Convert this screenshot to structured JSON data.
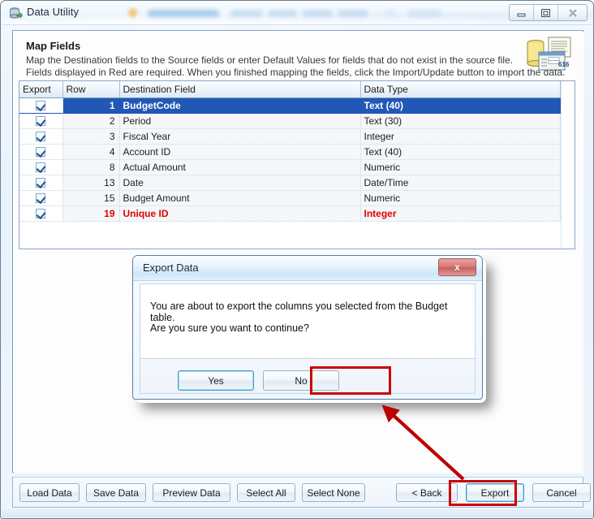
{
  "window": {
    "title": "Data Utility",
    "icon": "database-app-icon",
    "buttons": {
      "minimize": "minimize-icon",
      "restore": "restore-icon",
      "close": "close-icon"
    }
  },
  "panel": {
    "heading": "Map Fields",
    "description_line1": "Map the Destination fields to the Source fields or enter Default Values for fields that do not exist in the source file.",
    "description_line2": "Fields displayed in Red are required.  When you finished mapping the fields, click the Import/Update button to import the data.",
    "icon": "database-report-icon"
  },
  "grid": {
    "columns": [
      "Export",
      "Row",
      "Destination Field",
      "Data Type"
    ],
    "rows": [
      {
        "export": true,
        "row": "1",
        "field": "BudgetCode",
        "type": "Text (40)",
        "selected": true,
        "required": false
      },
      {
        "export": true,
        "row": "2",
        "field": "Period",
        "type": "Text (30)",
        "selected": false,
        "required": false
      },
      {
        "export": true,
        "row": "3",
        "field": "Fiscal Year",
        "type": "Integer",
        "selected": false,
        "required": false
      },
      {
        "export": true,
        "row": "4",
        "field": "Account ID",
        "type": "Text (40)",
        "selected": false,
        "required": false
      },
      {
        "export": true,
        "row": "8",
        "field": "Actual Amount",
        "type": "Numeric",
        "selected": false,
        "required": false
      },
      {
        "export": true,
        "row": "13",
        "field": "Date",
        "type": "Date/Time",
        "selected": false,
        "required": false
      },
      {
        "export": true,
        "row": "15",
        "field": "Budget Amount",
        "type": "Numeric",
        "selected": false,
        "required": false
      },
      {
        "export": true,
        "row": "19",
        "field": "Unique ID",
        "type": "Integer",
        "selected": false,
        "required": true
      }
    ]
  },
  "dialog": {
    "title": "Export Data",
    "close_label": "x",
    "message_line1": "You are about to export the columns you selected from the  Budget table.",
    "message_line2": "Are you sure you want to continue?",
    "yes_label": "Yes",
    "no_label": "No"
  },
  "toolbar": {
    "load_data": "Load Data",
    "save_data": "Save Data",
    "preview_data": "Preview Data",
    "select_all": "Select All",
    "select_none": "Select None",
    "back": "< Back",
    "export": "Export",
    "cancel": "Cancel"
  },
  "annotations": {
    "highlight_color": "#cc0000",
    "arrow": "red-arrow-export-to-dialog"
  },
  "colors": {
    "selection_blue": "#2157b5",
    "required_red": "#e00000",
    "annotation_red": "#cc0000",
    "focus_blue": "#3d9bd8"
  }
}
